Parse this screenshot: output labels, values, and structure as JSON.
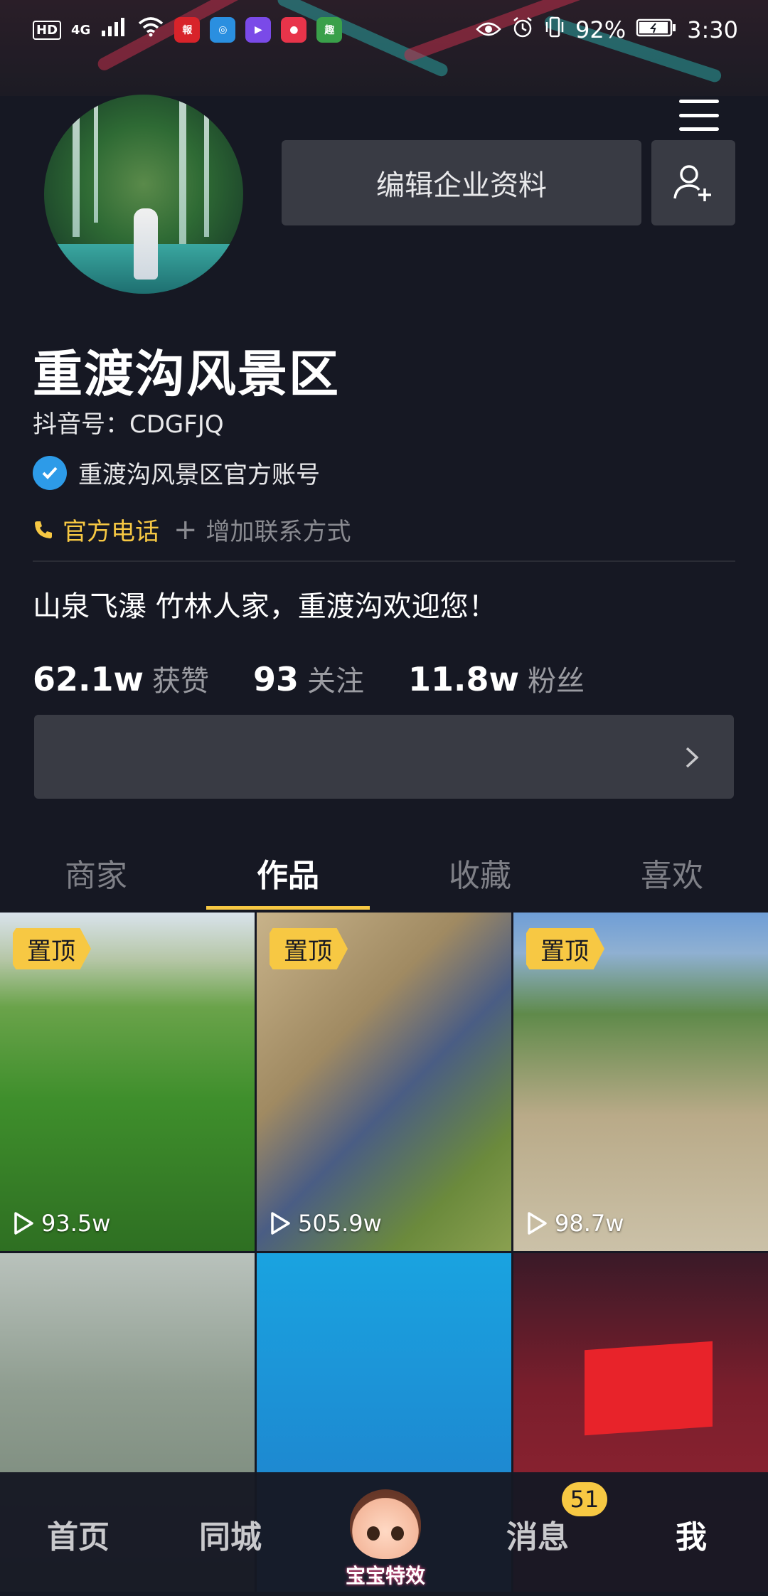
{
  "status_bar": {
    "hd": "HD",
    "network": "4G",
    "battery_pct": "92%",
    "time": "3:30",
    "apps": [
      {
        "name": "newspaper-app-icon",
        "color": "#d8232a"
      },
      {
        "name": "blue-app-icon",
        "color": "#2a8fe0"
      },
      {
        "name": "video-app-icon",
        "color": "#7a4ae8"
      },
      {
        "name": "red-app-icon",
        "color": "#e8344a"
      },
      {
        "name": "green-app-icon",
        "color": "#3aa04a"
      }
    ]
  },
  "profile": {
    "edit_button": "编辑企业资料",
    "name": "重渡沟风景区",
    "douyin_id": "抖音号：CDGFJQ",
    "verified_label": "重渡沟风景区官方账号",
    "phone_label": "官方电话",
    "add_contact_label": "增加联系方式",
    "bio": "山泉飞瀑 竹林人家，重渡沟欢迎您！"
  },
  "stats": [
    {
      "num": "62.1w",
      "label": "获赞"
    },
    {
      "num": "93",
      "label": "关注"
    },
    {
      "num": "11.8w",
      "label": "粉丝"
    }
  ],
  "tabs": [
    {
      "label": "商家",
      "active": false
    },
    {
      "label": "作品",
      "active": true
    },
    {
      "label": "收藏",
      "active": false
    },
    {
      "label": "喜欢",
      "active": false
    }
  ],
  "videos": [
    {
      "pinned": "置顶",
      "plays": "93.5w"
    },
    {
      "pinned": "置顶",
      "plays": "505.9w"
    },
    {
      "pinned": "置顶",
      "plays": "98.7w"
    },
    {
      "pinned": "",
      "plays": ""
    },
    {
      "pinned": "",
      "plays": ""
    },
    {
      "pinned": "",
      "plays": ""
    }
  ],
  "bottom_nav": {
    "home": "首页",
    "nearby": "同城",
    "center": "宝宝特效",
    "messages": "消息",
    "messages_badge": "51",
    "me": "我"
  },
  "colors": {
    "accent": "#f7c843",
    "background": "#161823",
    "verified_blue": "#2d9be8"
  }
}
